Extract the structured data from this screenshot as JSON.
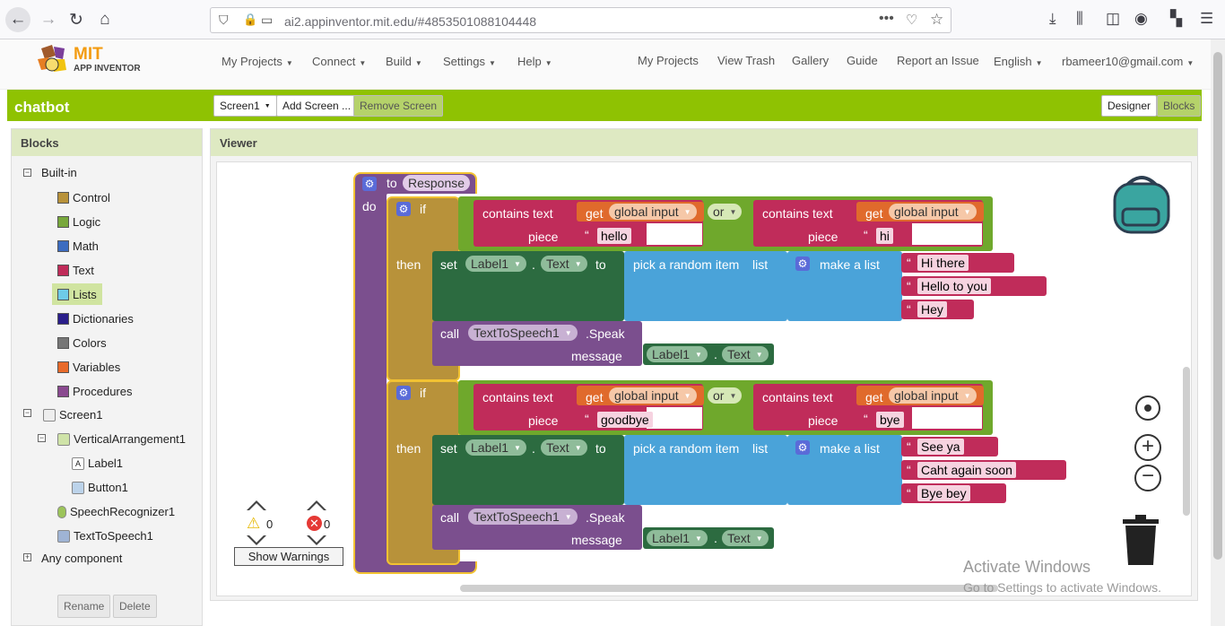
{
  "browser": {
    "url": "ai2.appinventor.mit.edu/#4853501088104448"
  },
  "header": {
    "logo_line1": "MIT",
    "logo_line2": "APP INVENTOR",
    "menus": [
      "My Projects",
      "Connect",
      "Build",
      "Settings",
      "Help"
    ],
    "links": [
      "My Projects",
      "View Trash",
      "Gallery",
      "Guide",
      "Report an Issue"
    ],
    "language": "English",
    "user": "rbameer10@gmail.com"
  },
  "project": {
    "name": "chatbot",
    "screen_select": "Screen1",
    "add_screen": "Add Screen ...",
    "remove_screen": "Remove Screen",
    "designer": "Designer",
    "blocks": "Blocks"
  },
  "blocks_panel": {
    "title": "Blocks",
    "builtin": "Built-in",
    "categories": [
      {
        "label": "Control",
        "color": "#b8923a"
      },
      {
        "label": "Logic",
        "color": "#78a83c"
      },
      {
        "label": "Math",
        "color": "#3c6cc0"
      },
      {
        "label": "Text",
        "color": "#c02c5a"
      },
      {
        "label": "Lists",
        "color": "#6ecbe8"
      },
      {
        "label": "Dictionaries",
        "color": "#2a1e8a"
      },
      {
        "label": "Colors",
        "color": "#777777"
      },
      {
        "label": "Variables",
        "color": "#e86a2a"
      },
      {
        "label": "Procedures",
        "color": "#8a4a90"
      }
    ],
    "components": [
      "Screen1",
      "VerticalArrangement1",
      "Label1",
      "Button1",
      "SpeechRecognizer1",
      "TextToSpeech1"
    ],
    "any": "Any component",
    "rename": "Rename",
    "delete": "Delete"
  },
  "viewer": {
    "title": "Viewer",
    "warn_count": "0",
    "error_count": "0",
    "show_warnings": "Show Warnings",
    "watermark1": "Activate Windows",
    "watermark2": "Go to Settings to activate Windows."
  },
  "blocks": {
    "to": "to",
    "proc_name": "Response",
    "do": "do",
    "if": "if",
    "then": "then",
    "contains_text": "contains text",
    "get": "get",
    "var": "global input",
    "or": "or",
    "piece": "piece",
    "set": "set",
    "label1": "Label1",
    "dot": ".",
    "text_prop": "Text",
    "to_kw": "to",
    "pick": "pick a random item",
    "list": "list",
    "make_list": "make a list",
    "call": "call",
    "tts": "TextToSpeech1",
    "speak": ".Speak",
    "message": "message",
    "q": "“",
    "q2": "”",
    "if1": {
      "p1": "hello",
      "p2": "hi",
      "items": [
        "Hi there",
        "Hello to you",
        "Hey"
      ]
    },
    "if2": {
      "p1": "goodbye",
      "p2": "bye",
      "items": [
        "See ya",
        "Caht again soon",
        "Bye bey"
      ]
    }
  }
}
